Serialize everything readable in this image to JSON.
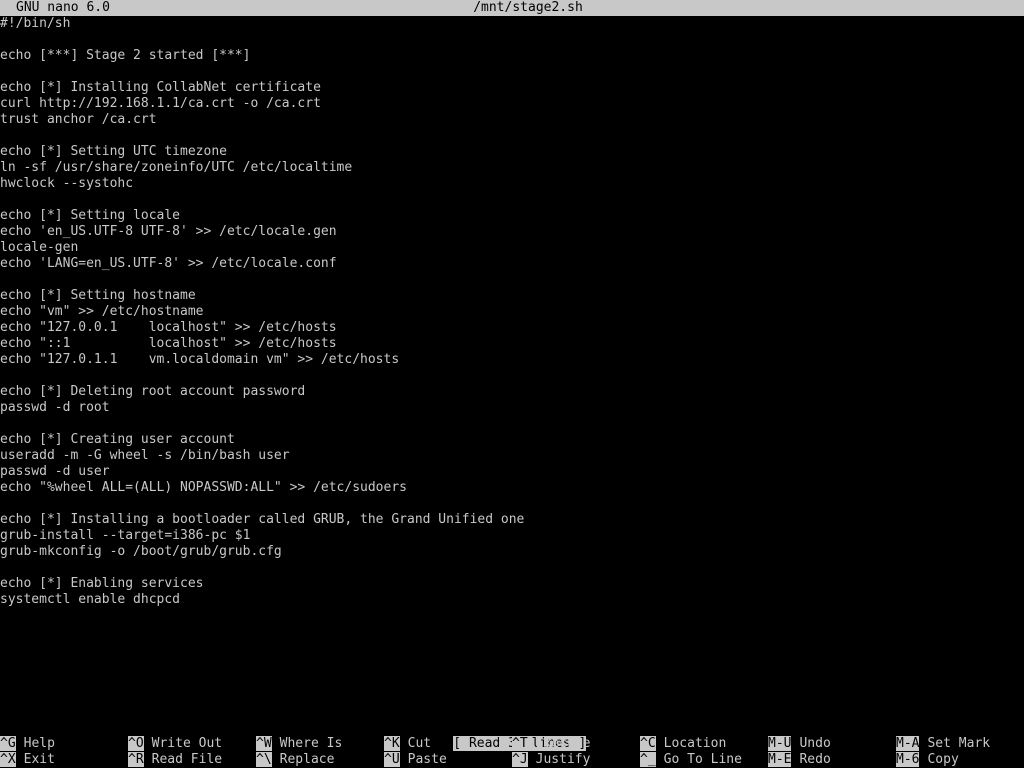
{
  "titlebar": {
    "version": "GNU nano 6.0",
    "filename": "/mnt/stage2.sh"
  },
  "editor": {
    "lines": [
      "#!/bin/sh",
      "",
      "echo [***] Stage 2 started [***]",
      "",
      "echo [*] Installing CollabNet certificate",
      "curl http://192.168.1.1/ca.crt -o /ca.crt",
      "trust anchor /ca.crt",
      "",
      "echo [*] Setting UTC timezone",
      "ln -sf /usr/share/zoneinfo/UTC /etc/localtime",
      "hwclock --systohc",
      "",
      "echo [*] Setting locale",
      "echo 'en_US.UTF-8 UTF-8' >> /etc/locale.gen",
      "locale-gen",
      "echo 'LANG=en_US.UTF-8' >> /etc/locale.conf",
      "",
      "echo [*] Setting hostname",
      "echo \"vm\" >> /etc/hostname",
      "echo \"127.0.0.1    localhost\" >> /etc/hosts",
      "echo \"::1          localhost\" >> /etc/hosts",
      "echo \"127.0.1.1    vm.localdomain vm\" >> /etc/hosts",
      "",
      "echo [*] Deleting root account password",
      "passwd -d root",
      "",
      "echo [*] Creating user account",
      "useradd -m -G wheel -s /bin/bash user",
      "passwd -d user",
      "echo \"%wheel ALL=(ALL) NOPASSWD:ALL\" >> /etc/sudoers",
      "",
      "echo [*] Installing a bootloader called GRUB, the Grand Unified one",
      "grub-install --target=i386-pc $1",
      "grub-mkconfig -o /boot/grub/grub.cfg",
      "",
      "echo [*] Enabling services",
      "systemctl enable dhcpcd"
    ]
  },
  "status": "[ Read 37 lines ]",
  "shortcuts": [
    {
      "key": "^G",
      "label": "Help"
    },
    {
      "key": "^O",
      "label": "Write Out"
    },
    {
      "key": "^W",
      "label": "Where Is"
    },
    {
      "key": "^K",
      "label": "Cut"
    },
    {
      "key": "^T",
      "label": "Execute"
    },
    {
      "key": "^C",
      "label": "Location"
    },
    {
      "key": "M-U",
      "label": "Undo"
    },
    {
      "key": "M-A",
      "label": "Set Mark"
    },
    {
      "key": "^X",
      "label": "Exit"
    },
    {
      "key": "^R",
      "label": "Read File"
    },
    {
      "key": "^\\",
      "label": "Replace"
    },
    {
      "key": "^U",
      "label": "Paste"
    },
    {
      "key": "^J",
      "label": "Justify"
    },
    {
      "key": "^_",
      "label": "Go To Line"
    },
    {
      "key": "M-E",
      "label": "Redo"
    },
    {
      "key": "M-6",
      "label": "Copy"
    }
  ]
}
